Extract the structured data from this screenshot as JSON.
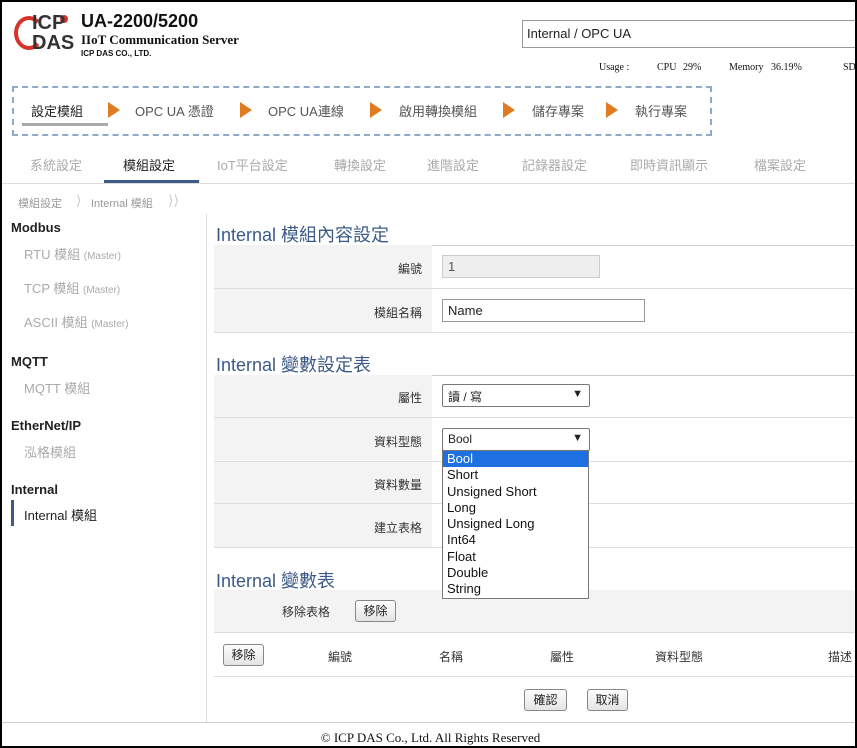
{
  "header": {
    "logo_top": "ICP",
    "logo_bottom": "DAS",
    "product_title": "UA-2200/5200",
    "product_subtitle": "IIoT Communication Server",
    "company": "ICP DAS CO., LTD.",
    "top_select_value": "Internal / OPC UA",
    "usage_label": "Usage :",
    "cpu_label": "CPU",
    "cpu_value": "29%",
    "memory_label": "Memory",
    "memory_value": "36.19%",
    "sd_label": "SD"
  },
  "wizard": {
    "steps": [
      "設定模組",
      "OPC UA 憑證",
      "OPC UA連線",
      "啟用轉換模組",
      "儲存專案",
      "執行專案"
    ],
    "active_index": 0,
    "arrow_color": "#e07b22"
  },
  "nav": {
    "tabs": [
      "系統設定",
      "模組設定",
      "IoT平台設定",
      "轉換設定",
      "進階設定",
      "記錄器設定",
      "即時資訊顯示",
      "檔案設定"
    ],
    "active_index": 1,
    "accent_color": "#3b5a86"
  },
  "breadcrumb": [
    "模組設定",
    "Internal 模組"
  ],
  "sidebar": {
    "groups": [
      {
        "title": "Modbus",
        "items": [
          {
            "label": "RTU 模組",
            "note": "(Master)"
          },
          {
            "label": "TCP 模組",
            "note": "(Master)"
          },
          {
            "label": "ASCII 模組",
            "note": "(Master)"
          }
        ]
      },
      {
        "title": "MQTT",
        "items": [
          {
            "label": "MQTT 模組",
            "note": ""
          }
        ]
      },
      {
        "title": "EtherNet/IP",
        "items": [
          {
            "label": "泓格模組",
            "note": ""
          }
        ]
      },
      {
        "title": "Internal",
        "items": [
          {
            "label": "Internal 模組",
            "note": ""
          }
        ]
      }
    ]
  },
  "module_section": {
    "title": "Internal 模組內容設定",
    "id_label": "編號",
    "id_value": "1",
    "name_label": "模組名稱",
    "name_value": "Name"
  },
  "variable_section": {
    "title": "Internal 變數設定表",
    "attr_label": "屬性",
    "attr_value": "讀 / 寫",
    "type_label": "資料型態",
    "type_value": "Bool",
    "count_label": "資料數量",
    "create_label": "建立表格",
    "type_options": [
      "Bool",
      "Short",
      "Unsigned Short",
      "Long",
      "Unsigned Long",
      "Int64",
      "Float",
      "Double",
      "String"
    ],
    "highlighted_option": 0,
    "highlight_color": "#1e6fe0"
  },
  "variable_table": {
    "title": "Internal 變數表",
    "remove_table_label": "移除表格",
    "remove_button": "移除",
    "columns": [
      "移除",
      "編號",
      "名稱",
      "屬性",
      "資料型態",
      "描述"
    ],
    "confirm_button": "確認",
    "cancel_button": "取消"
  },
  "footer": {
    "copyright": "© ICP DAS Co., Ltd. All Rights Reserved"
  }
}
